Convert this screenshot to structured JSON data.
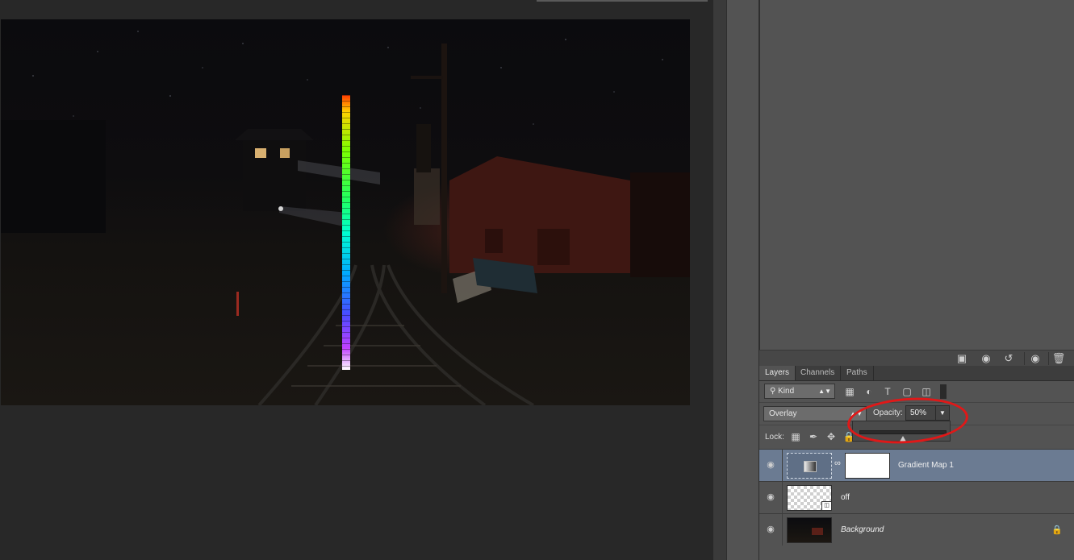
{
  "panel_tabs": [
    {
      "label": "Layers",
      "active": true
    },
    {
      "label": "Channels",
      "active": false
    },
    {
      "label": "Paths",
      "active": false
    }
  ],
  "filter": {
    "kind_label": "Kind",
    "icons": [
      "pixel-filter-icon",
      "adjustment-filter-icon",
      "type-filter-icon",
      "shape-filter-icon",
      "smart-object-filter-icon",
      "filter-toggle-icon"
    ]
  },
  "blend": {
    "mode": "Overlay",
    "opacity_label": "Opacity:",
    "opacity_value": "50%",
    "opacity_fraction": 0.5
  },
  "lock": {
    "label": "Lock:",
    "icons": [
      "lock-transparent-icon",
      "lock-brush-icon",
      "lock-move-icon",
      "lock-all-icon"
    ]
  },
  "layers": [
    {
      "name": "Gradient Map 1",
      "selected": true,
      "visible": true,
      "thumb": "gradient-map",
      "has_mask": true,
      "locked": false,
      "italic": false
    },
    {
      "name": "off",
      "selected": false,
      "visible": true,
      "thumb": "transparent",
      "has_mask": false,
      "locked": false,
      "italic": false,
      "smart_object": true
    },
    {
      "name": "Background",
      "selected": false,
      "visible": true,
      "thumb": "photo",
      "has_mask": false,
      "locked": true,
      "italic": true
    }
  ],
  "history_footer_icons": [
    "new-document-icon",
    "snapshot-icon",
    "revert-icon",
    "visibility-icon",
    "trash-icon"
  ],
  "colors": {
    "selected_row": "#6b7b92",
    "panel": "#535353",
    "annotation": "#e01818"
  }
}
